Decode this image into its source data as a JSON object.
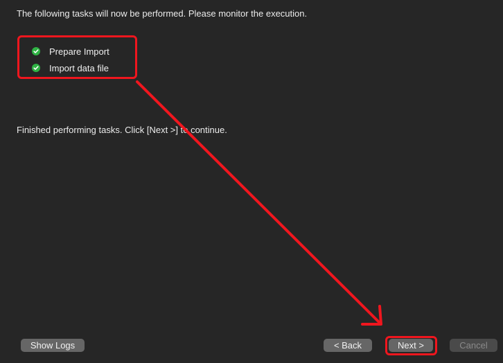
{
  "intro_text": "The following tasks will now be performed. Please monitor the execution.",
  "tasks": [
    {
      "label": "Prepare Import",
      "status": "completed"
    },
    {
      "label": "Import data file",
      "status": "completed"
    }
  ],
  "finished_text": "Finished performing tasks. Click [Next >] to continue.",
  "buttons": {
    "show_logs": "Show Logs",
    "back": "< Back",
    "next": "Next >",
    "cancel": "Cancel"
  },
  "colors": {
    "background": "#262626",
    "check_green": "#2fb344",
    "annotation_red": "#f0161e"
  },
  "icons": {
    "task_status": "check-circle-icon"
  }
}
